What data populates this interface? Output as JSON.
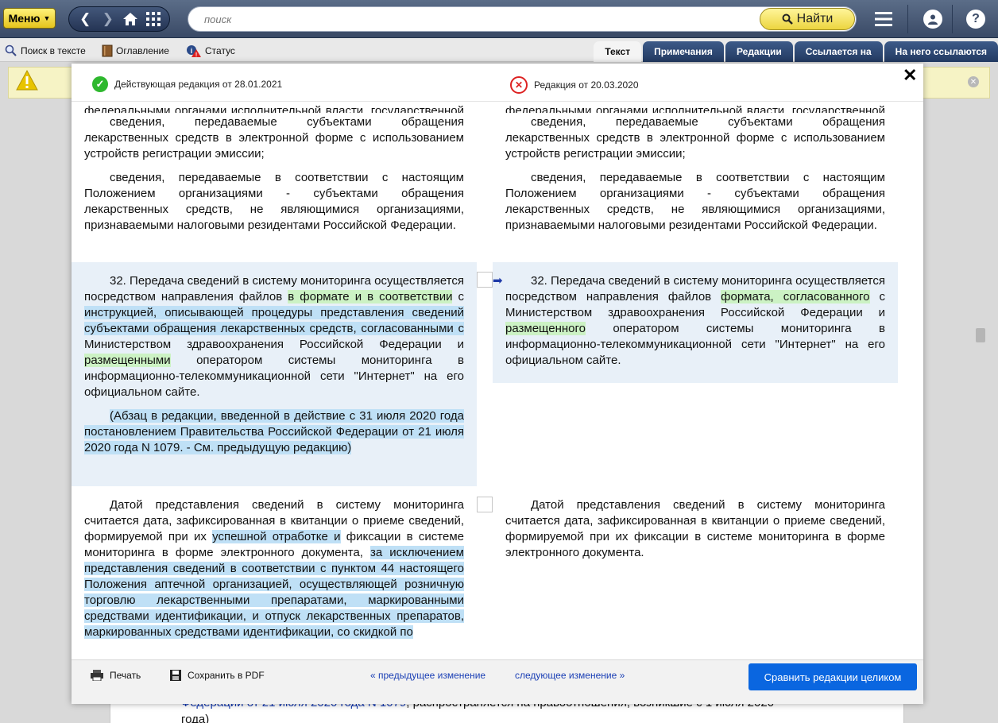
{
  "topbar": {
    "menu_label": "Меню",
    "search_placeholder": "поиск",
    "find_label": "Найти"
  },
  "toolbar2": {
    "search_in_text": "Поиск в тексте",
    "contents": "Оглавление",
    "status": "Статус",
    "tabs": [
      {
        "label": "Текст",
        "active": true
      },
      {
        "label": "Примечания",
        "active": false
      },
      {
        "label": "Редакции",
        "active": false
      },
      {
        "label": "Ссылается на",
        "active": false
      },
      {
        "label": "На него ссылаются",
        "active": false
      }
    ]
  },
  "background": {
    "link_text": "Федерации от 21 июля 2020 года N 1079",
    "tail_text": ", распространяется на правоотношения, возникшие с 1 июля 2020",
    "last_line": "года)"
  },
  "modal": {
    "current_revision": "Действующая редакция от 28.01.2021",
    "old_revision": "Редакция от 20.03.2020",
    "left": {
      "cut_top": "федеральными органами исполнительной власти, государственной власти субъектов Российской Федерации;",
      "p1": "сведения, передаваемые субъектами обращения лекарственных средств в электронной форме с использованием устройств регистрации эмиссии;",
      "p2": "сведения, передаваемые в соответствии с настоящим Положением организациями - субъектами обращения лекарственных средств, не являющимися организациями, признаваемыми налоговыми резидентами Российской Федерации.",
      "p32_a": "32. Передача сведений в систему мониторинга осуществляется посредством направления файлов ",
      "p32_hl1": "в формате и в соответствии",
      "p32_b": " с ",
      "p32_hl2": "инструкцией, описывающей процедуры представления сведений субъектами обращения лекарственных средств, согласованными с",
      "p32_c": " Министерством здравоохранения Российской Федерации и ",
      "p32_hl3": "размещенными",
      "p32_d": " оператором системы мониторинга в информационно-телекоммуникационной сети \"Интернет\" на его официальном сайте.",
      "note": "(Абзац в редакции, введенной в действие с 31 июля 2020 года постановлением Правительства Российской Федерации от 21 июля 2020 года N 1079. - См. предыдущую редакцию)",
      "p3_a": "Датой представления сведений в систему мониторинга считается дата, зафиксированная в квитанции о приеме сведений, формируемой при их ",
      "p3_hl1": "успешной отработке и",
      "p3_b": " фиксации в системе мониторинга в форме электронного документа, ",
      "p3_hl2": "за исключением представления сведений в соответствии с пунктом 44 настоящего Положения аптечной организацией, осуществляющей розничную торговлю лекарственными препаратами, маркированными средствами идентификации, и отпуск лекарственных препаратов, маркированных средствами идентификации, со скидкой по"
    },
    "right": {
      "p1": "сведения, передаваемые субъектами обращения лекарственных средств в электронной форме с использованием устройств регистрации эмиссии;",
      "p2": "сведения, передаваемые в соответствии с настоящим Положением организациями - субъектами обращения лекарственных средств, не являющимися организациями, признаваемыми налоговыми резидентами Российской Федерации.",
      "p32_a": "32. Передача сведений в систему мониторинга осуществляется посредством направления файлов ",
      "p32_hl1": "формата, согласованного",
      "p32_b": " с Министерством здравоохранения Российской Федерации и ",
      "p32_hl2": "размещенного",
      "p32_c": " оператором системы мониторинга в информационно-телекоммуникационной сети \"Интернет\" на его официальном сайте.",
      "p3": "Датой представления сведений в систему мониторинга считается дата, зафиксированная в квитанции о приеме сведений, формируемой при их фиксации в системе мониторинга в форме электронного документа."
    },
    "footer": {
      "print": "Печать",
      "save_pdf": "Сохранить в PDF",
      "prev_change": "« предыдущее изменение",
      "next_change": "следующее изменение »",
      "compare": "Сравнить редакции целиком"
    }
  },
  "colors": {
    "change_block": "#e8f0f8",
    "highlight_changed": "#ccf2c4",
    "highlight_removed": "#bfe0f6",
    "accent": "#0a66e0"
  }
}
